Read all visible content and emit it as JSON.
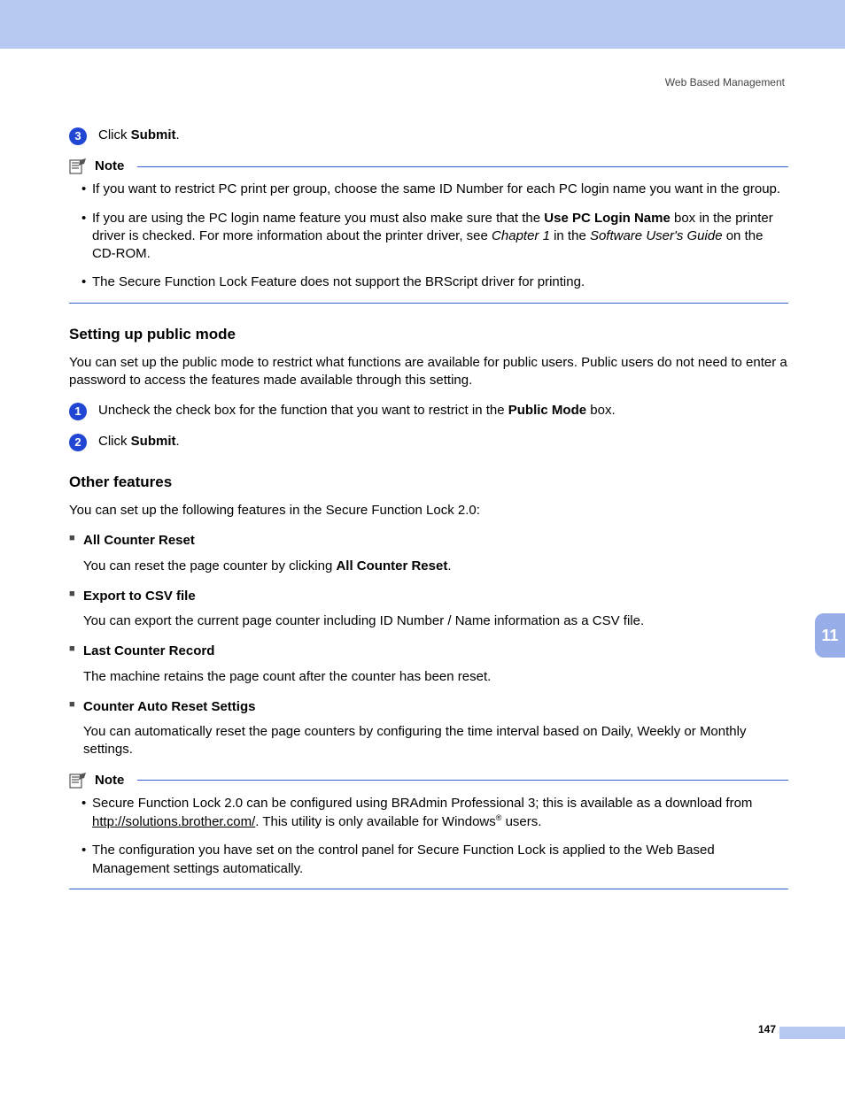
{
  "docTitle": "Web Based Management",
  "pageNumber": "147",
  "chapterTab": "11",
  "step3": {
    "num": "3",
    "pre": "Click ",
    "bold": "Submit",
    "post": "."
  },
  "note1": {
    "label": "Note",
    "items": [
      {
        "segs": [
          {
            "t": "If you want to restrict PC print per group, choose the same ID Number for each PC login name you want in the group."
          }
        ]
      },
      {
        "segs": [
          {
            "t": "If you are using the PC login name feature you must also make sure that the "
          },
          {
            "t": "Use PC Login Name",
            "b": true
          },
          {
            "t": " box in the printer driver is checked. For more information about the printer driver, see "
          },
          {
            "t": "Chapter 1",
            "i": true
          },
          {
            "t": " in the "
          },
          {
            "t": "Software User's Guide",
            "i": true
          },
          {
            "t": " on the CD-ROM."
          }
        ]
      },
      {
        "segs": [
          {
            "t": "The Secure Function Lock Feature does not support the BRScript driver for printing."
          }
        ]
      }
    ]
  },
  "publicMode": {
    "heading": "Setting up public mode",
    "intro": "You can set up the public mode to restrict what functions are available for public users. Public users do not need to enter a password to access the features made available through this setting.",
    "step1": {
      "num": "1",
      "pre": "Uncheck the check box for the function that you want to restrict in the ",
      "bold": "Public Mode",
      "post": " box."
    },
    "step2": {
      "num": "2",
      "pre": "Click ",
      "bold": "Submit",
      "post": "."
    }
  },
  "other": {
    "heading": "Other features",
    "intro": "You can set up the following features in the Secure Function Lock 2.0:",
    "features": [
      {
        "title": "All Counter Reset",
        "descSegs": [
          {
            "t": "You can reset the page counter by clicking "
          },
          {
            "t": "All Counter Reset",
            "b": true
          },
          {
            "t": "."
          }
        ]
      },
      {
        "title": "Export to CSV file",
        "descSegs": [
          {
            "t": "You can export the current page counter including ID Number / Name information as a CSV file."
          }
        ]
      },
      {
        "title": "Last Counter Record",
        "descSegs": [
          {
            "t": "The machine retains the page count after the counter has been reset."
          }
        ]
      },
      {
        "title": "Counter Auto Reset Settigs",
        "descSegs": [
          {
            "t": "You can automatically reset the page counters by configuring the time interval based on Daily, Weekly or Monthly settings."
          }
        ]
      }
    ]
  },
  "note2": {
    "label": "Note",
    "items": [
      {
        "segs": [
          {
            "t": "Secure Function Lock 2.0 can be configured using BRAdmin Professional 3; this is available as a download from "
          },
          {
            "t": "http://solutions.brother.com/",
            "u": true
          },
          {
            "t": ". This utility is only available for Windows"
          },
          {
            "t": "®",
            "sup": true
          },
          {
            "t": " users."
          }
        ]
      },
      {
        "segs": [
          {
            "t": "The configuration you have set on the control panel for Secure Function Lock is applied to the Web Based Management settings automatically."
          }
        ]
      }
    ]
  }
}
